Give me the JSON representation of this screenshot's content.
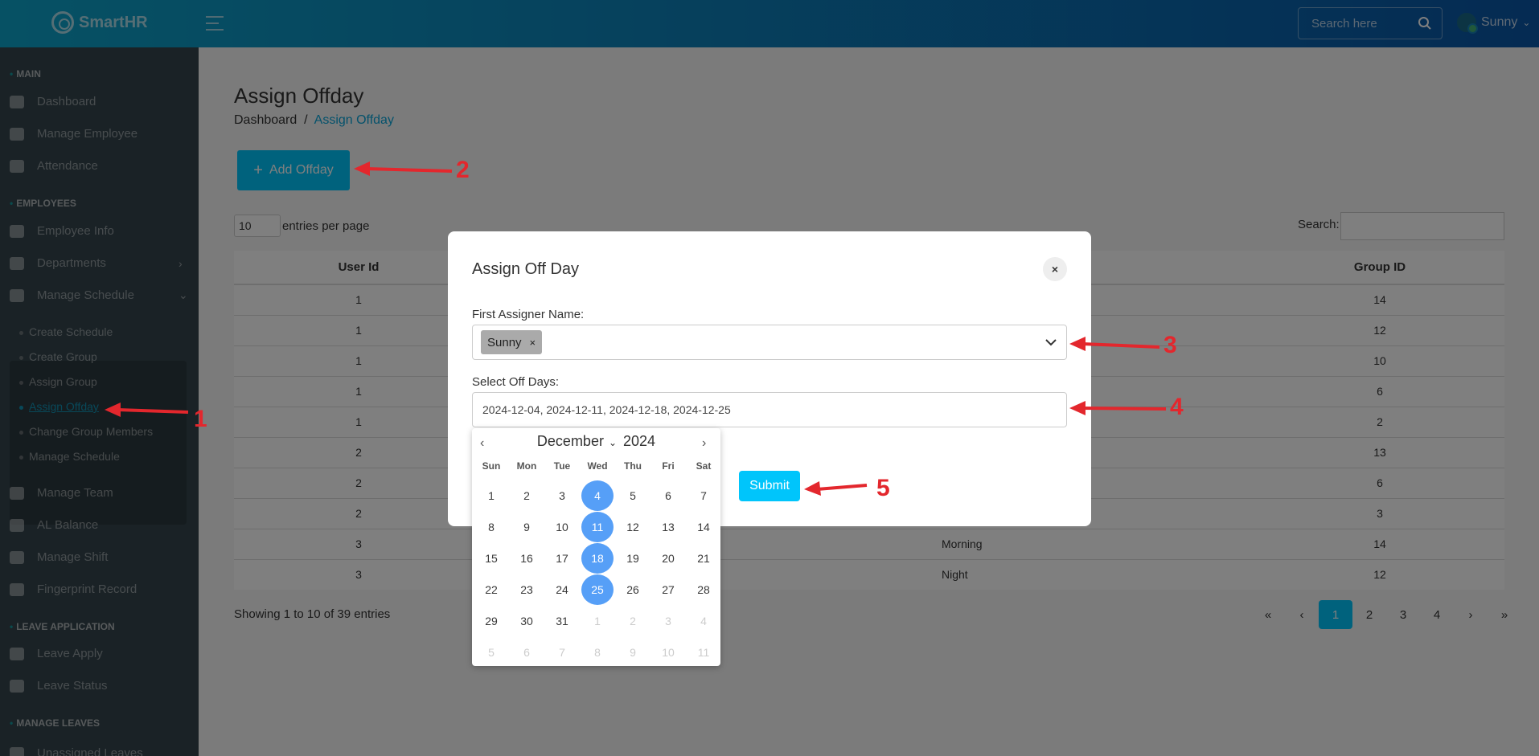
{
  "app": {
    "name": "SmartHR"
  },
  "topbar": {
    "search_placeholder": "Search here",
    "user_name": "Sunny"
  },
  "sidebar": {
    "sections": [
      "MAIN",
      "EMPLOYEES",
      "LEAVE APPLICATION",
      "MANAGE LEAVES"
    ],
    "items": [
      "Dashboard",
      "Manage Employee",
      "Attendance",
      "Employee Info",
      "Departments",
      "Manage Schedule",
      "Manage Team",
      "AL Balance",
      "Manage Shift",
      "Fingerprint Record",
      "Leave Apply",
      "Leave Status",
      "Unassigned Leaves"
    ],
    "sub_items": [
      "Create Schedule",
      "Create Group",
      "Assign Group",
      "Assign Offday",
      "Change Group Members",
      "Manage Schedule"
    ]
  },
  "page": {
    "title": "Assign Offday",
    "breadcrumb": [
      "Dashboard",
      "/",
      "Assign Offday"
    ],
    "add_button": "Add Offday",
    "entries_value": "10",
    "entries_label": "entries per page",
    "search_label": "Search:",
    "table": {
      "headers": [
        "User Id",
        "Group ID"
      ],
      "rows": [
        {
          "user": "1",
          "mid": "",
          "group": "14"
        },
        {
          "user": "1",
          "mid": "",
          "group": "12"
        },
        {
          "user": "1",
          "mid": "",
          "group": "10"
        },
        {
          "user": "1",
          "mid": "",
          "group": "6"
        },
        {
          "user": "1",
          "mid": "",
          "group": "2"
        },
        {
          "user": "2",
          "mid": "",
          "group": "13"
        },
        {
          "user": "2",
          "mid": "",
          "group": "6"
        },
        {
          "user": "2",
          "mid": "",
          "group": "3"
        },
        {
          "user": "3",
          "mid": "Morning",
          "group": "14"
        },
        {
          "user": "3",
          "mid": "Night",
          "group": "12"
        }
      ]
    },
    "showing": "Showing 1 to 10 of 39 entries",
    "pagination": [
      "«",
      "‹",
      "1",
      "2",
      "3",
      "4",
      "›",
      "»"
    ]
  },
  "modal": {
    "title": "Assign Off Day",
    "close": "×",
    "assigner_label": "First Assigner Name:",
    "assigner_tag": "Sunny",
    "tag_remove": "×",
    "offdays_label": "Select Off Days:",
    "offdays_value": "2024-12-04, 2024-12-11, 2024-12-18, 2024-12-25",
    "submit": "Submit"
  },
  "calendar": {
    "month": "December",
    "year": "2024",
    "weekdays": [
      "Sun",
      "Mon",
      "Tue",
      "Wed",
      "Thu",
      "Fri",
      "Sat"
    ],
    "days": [
      "1",
      "2",
      "3",
      "4",
      "5",
      "6",
      "7",
      "8",
      "9",
      "10",
      "11",
      "12",
      "13",
      "14",
      "15",
      "16",
      "17",
      "18",
      "19",
      "20",
      "21",
      "22",
      "23",
      "24",
      "25",
      "26",
      "27",
      "28",
      "29",
      "30",
      "31",
      "1",
      "2",
      "3",
      "4",
      "5",
      "6",
      "7",
      "8",
      "9",
      "10",
      "11"
    ],
    "selected": [
      "4",
      "11",
      "18",
      "25"
    ]
  },
  "annotations": [
    "1",
    "2",
    "3",
    "4",
    "5"
  ],
  "colors": {
    "accent": "#00c5fb",
    "annotation": "#e3272d",
    "selected_day": "#569ff7"
  }
}
